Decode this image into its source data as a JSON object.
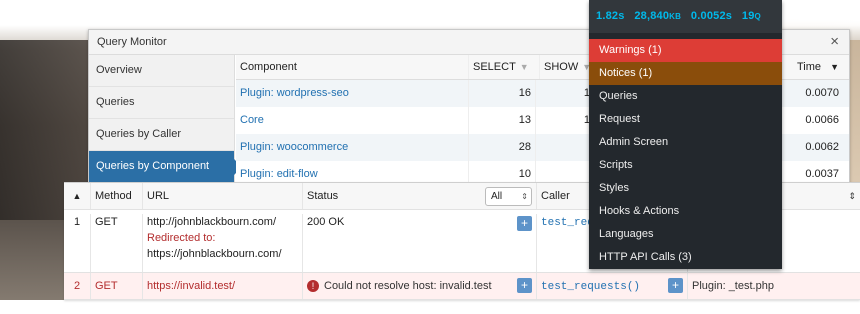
{
  "admin_bar": {
    "stats": {
      "time": "1.82s",
      "memory_value": "28,840",
      "memory_unit": "KB",
      "db_time": "0.0052s",
      "queries_value": "19",
      "queries_unit": "Q"
    },
    "menu": [
      {
        "label": "Warnings (1)",
        "kind": "warn"
      },
      {
        "label": "Notices (1)",
        "kind": "notice"
      },
      {
        "label": "Queries",
        "kind": ""
      },
      {
        "label": "Request",
        "kind": ""
      },
      {
        "label": "Admin Screen",
        "kind": ""
      },
      {
        "label": "Scripts",
        "kind": ""
      },
      {
        "label": "Styles",
        "kind": ""
      },
      {
        "label": "Hooks & Actions",
        "kind": ""
      },
      {
        "label": "Languages",
        "kind": ""
      },
      {
        "label": "HTTP API Calls (3)",
        "kind": ""
      }
    ]
  },
  "panel": {
    "title": "Query Monitor",
    "close_icon": "×",
    "nav": [
      "Overview",
      "Queries",
      "Queries by Caller",
      "Queries by Component"
    ],
    "active_nav_index": 3
  },
  "component_table": {
    "headers": {
      "component": "Component",
      "select": "SELECT",
      "show": "SHOW",
      "time": "Time"
    },
    "sort_caret": "▼",
    "time_sort_caret": "▼",
    "rows": [
      {
        "component": "Plugin: wordpress-seo",
        "select": "16",
        "show": "1",
        "time": "0.0070"
      },
      {
        "component": "Core",
        "select": "13",
        "show": "1",
        "time": "0.0066"
      },
      {
        "component": "Plugin: woocommerce",
        "select": "28",
        "show": "",
        "time": "0.0062"
      },
      {
        "component": "Plugin: edit-flow",
        "select": "10",
        "show": "",
        "time": "0.0037"
      }
    ]
  },
  "http_table": {
    "headers": {
      "num_sort": "▲",
      "method": "Method",
      "url": "URL",
      "status": "Status",
      "filter_value": "All",
      "filter_arrow": "⇕",
      "caller": "Caller",
      "comp_arrow": "⇕"
    },
    "plus_label": "+",
    "rows": [
      {
        "num": "1",
        "method": "GET",
        "url": "http://johnblackbourn.com/",
        "redirect_label": "Redirected to:",
        "redirect_url": "https://johnblackbourn.com/",
        "status": "200 OK",
        "caller": "test_req",
        "component": ""
      },
      {
        "num": "2",
        "method": "GET",
        "url": "https://invalid.test/",
        "status_icon": "!",
        "status": "Could not resolve host: invalid.test",
        "caller": "test_requests()",
        "component": "Plugin: _test.php"
      }
    ]
  },
  "colors": {
    "active_nav": "#2b6fa6",
    "warning": "#dd3d36",
    "notice": "#8a4d0b",
    "stats": "#00b9eb",
    "admin_bar": "#23282d"
  }
}
